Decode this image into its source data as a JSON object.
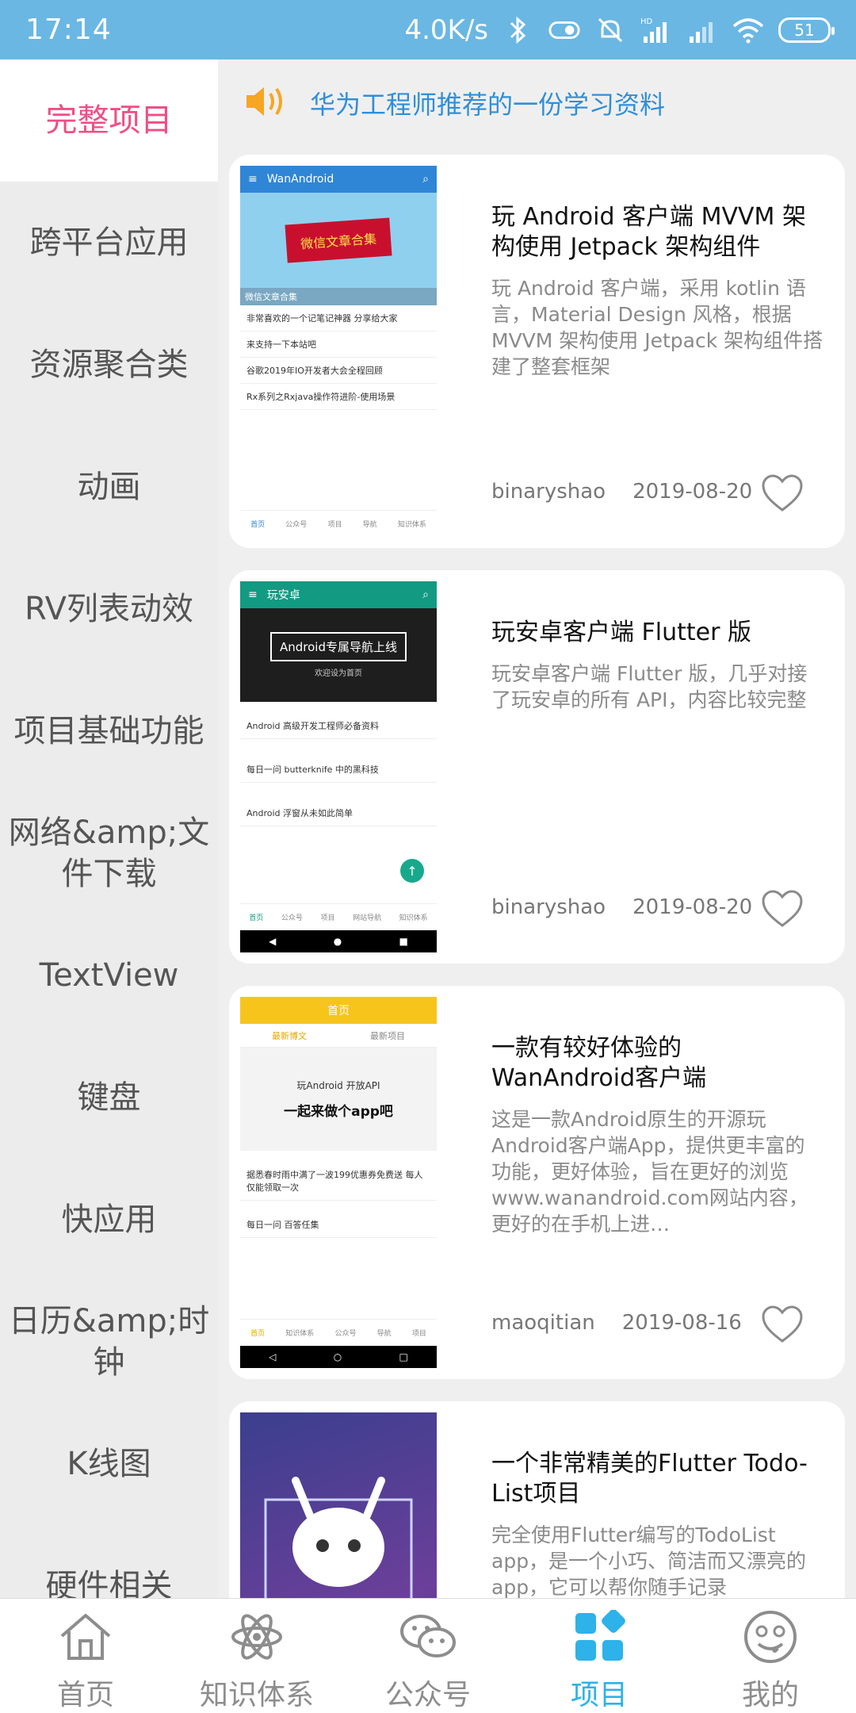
{
  "status_bar": {
    "time": "17:14",
    "net_speed": "4.0K/s",
    "battery": "51",
    "icons": [
      "bluetooth-icon",
      "toggle-icon",
      "alarm-off-icon",
      "hd-signal-icon",
      "signal-icon",
      "wifi-icon",
      "battery-icon"
    ]
  },
  "sidebar": {
    "items": [
      {
        "label": "完整项目",
        "active": true
      },
      {
        "label": "跨平台应用"
      },
      {
        "label": "资源聚合类"
      },
      {
        "label": "动画"
      },
      {
        "label": "RV列表动效"
      },
      {
        "label": "项目基础功能"
      },
      {
        "label": "网络&amp;文件下载"
      },
      {
        "label": "TextView"
      },
      {
        "label": "键盘"
      },
      {
        "label": "快应用"
      },
      {
        "label": "日历&amp;时钟"
      },
      {
        "label": "K线图"
      },
      {
        "label": "硬件相关"
      }
    ]
  },
  "notice": {
    "icon": "speaker-icon",
    "text": "华为工程师推荐的一份学习资料"
  },
  "projects": [
    {
      "title": "玩 Android 客户端  MVVM 架构使用 Jetpack 架构组件",
      "desc": "玩 Android 客户端，采用 kotlin 语言，Material Design 风格，根据 MVVM 架构使用 Jetpack 架构组件搭建了整套框架",
      "author": "binaryshao",
      "date": "2019-08-20",
      "thumb": {
        "app_title": "WanAndroid",
        "banner": "微信文章合集",
        "section": "微信文章合集",
        "rows": [
          "非常喜欢的一个记笔记神器 分享给大家",
          "来支持一下本站吧",
          "谷歌2019年IO开发者大会全程回顾",
          "Rx系列之Rxjava操作符进阶-使用场景"
        ],
        "tabs": [
          "首页",
          "公众号",
          "项目",
          "导航",
          "知识体系"
        ]
      }
    },
    {
      "title": "玩安卓客户端 Flutter 版",
      "desc": "玩安卓客户端 Flutter 版，几乎对接了玩安卓的所有 API，内容比较完整",
      "author": "binaryshao",
      "date": "2019-08-20",
      "thumb": {
        "app_title": "玩安卓",
        "banner": "Android专属导航上线",
        "banner_sub": "欢迎设为首页",
        "rows": [
          "Android 高级开发工程师必备资料",
          "每日一问 butterknife 中的黑科技",
          "Android 浮窗从未如此简单"
        ],
        "tabs": [
          "首页",
          "公众号",
          "项目",
          "网站导航",
          "知识体系"
        ]
      }
    },
    {
      "title": "一款有较好体验的WanAndroid客户端",
      "desc": "这是一款Android原生的开源玩Android客户端App，提供更丰富的功能，更好体验，旨在更好的浏览www.wanandroid.com网站内容，更好的在手机上进…",
      "author": "maoqitian",
      "date": "2019-08-16",
      "thumb": {
        "app_title": "首页",
        "tab_a": "最新博文",
        "tab_b": "最新项目",
        "banner": "一起来做个app吧",
        "banner_sub": "玩Android 开放API",
        "rows": [
          "据悉春时雨中满了一波199优惠券免费送 每人仅能领取一次",
          "每日一问 百答任集"
        ],
        "tabs": [
          "首页",
          "知识体系",
          "公众号",
          "导航",
          "项目"
        ]
      }
    },
    {
      "title": "一个非常精美的Flutter Todo-List项目",
      "desc": "完全使用Flutter编写的TodoList app，是一个小巧、简洁而又漂亮的app，它可以帮你随手记录",
      "author": "",
      "date": "",
      "thumb": {}
    }
  ],
  "bottom_nav": {
    "items": [
      {
        "label": "首页",
        "icon": "home-icon"
      },
      {
        "label": "知识体系",
        "icon": "atom-icon"
      },
      {
        "label": "公众号",
        "icon": "wechat-icon"
      },
      {
        "label": "项目",
        "icon": "grid-icon",
        "active": true
      },
      {
        "label": "我的",
        "icon": "smiley-icon"
      }
    ]
  },
  "colors": {
    "status_bar": "#6ab7e3",
    "accent_pink": "#ef4e86",
    "accent_blue": "#2db2ea",
    "notice_text": "#2f8fd8"
  }
}
